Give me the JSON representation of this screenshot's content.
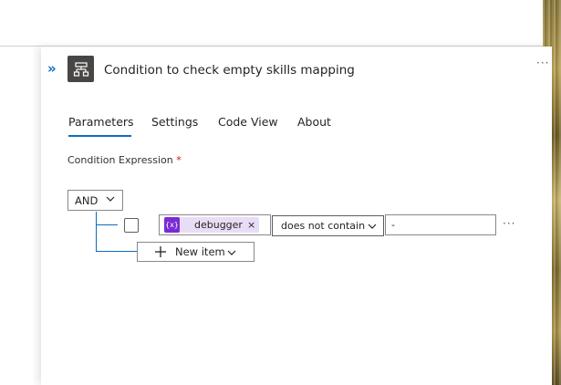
{
  "panel": {
    "title": "Condition to check empty skills mapping",
    "more_glyph": "···",
    "collapse_glyph": "»"
  },
  "tabs": [
    {
      "label": "Parameters",
      "selected": true
    },
    {
      "label": "Settings",
      "selected": false
    },
    {
      "label": "Code View",
      "selected": false
    },
    {
      "label": "About",
      "selected": false
    }
  ],
  "condition": {
    "label": "Condition Expression",
    "required_mark": "*",
    "group_operator": "AND",
    "row": {
      "checked": false,
      "operand1_token": {
        "icon_text": "{x}",
        "label": "debugger",
        "remove_glyph": "×"
      },
      "operator": "does not contain",
      "operand2": "-",
      "more_glyph": "···"
    },
    "new_item_label": "New item"
  },
  "colors": {
    "accent": "#0f6cbd",
    "action_icon_bg": "#484644",
    "token_bg": "#e9ddf6",
    "token_icon_bg": "#7a2bd3",
    "required": "#c50f1f"
  },
  "icons": {
    "action": "condition-icon",
    "collapse": "double-chevron-right-icon",
    "dropdown": "chevron-down-icon",
    "add": "plus-icon",
    "token": "variable-icon"
  }
}
